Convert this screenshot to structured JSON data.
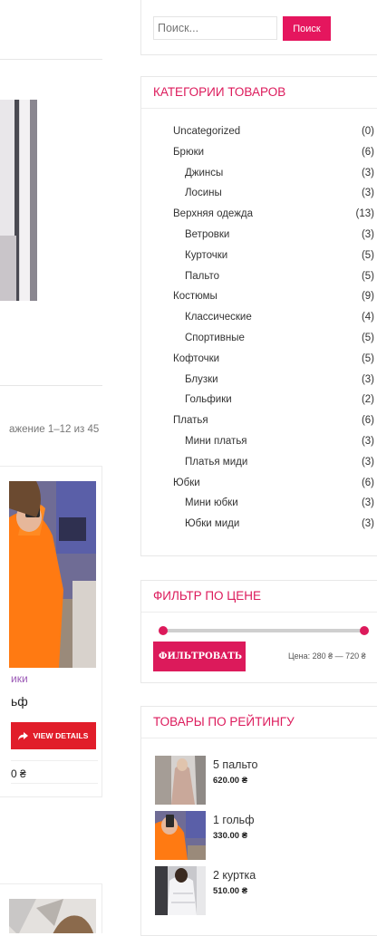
{
  "content": {
    "result_count": "ажение 1–12 из 45",
    "product_card": {
      "category": "ики",
      "name": "ьф",
      "button_label": "VIEW DETAILS",
      "price": "0 ₴"
    }
  },
  "search": {
    "placeholder": "Поиск...",
    "button_label": "Поиск"
  },
  "categories": {
    "title": "КАТЕГОРИИ ТОВАРОВ",
    "items": [
      {
        "label": "Uncategorized",
        "count": "(0)",
        "level": 0
      },
      {
        "label": "Брюки",
        "count": "(6)",
        "level": 0
      },
      {
        "label": "Джинсы",
        "count": "(3)",
        "level": 1
      },
      {
        "label": "Лосины",
        "count": "(3)",
        "level": 1
      },
      {
        "label": "Верхняя одежда",
        "count": "(13)",
        "level": 0
      },
      {
        "label": "Ветровки",
        "count": "(3)",
        "level": 1
      },
      {
        "label": "Курточки",
        "count": "(5)",
        "level": 1
      },
      {
        "label": "Пальто",
        "count": "(5)",
        "level": 1
      },
      {
        "label": "Костюмы",
        "count": "(9)",
        "level": 0
      },
      {
        "label": "Классические",
        "count": "(4)",
        "level": 1
      },
      {
        "label": "Спортивные",
        "count": "(5)",
        "level": 1
      },
      {
        "label": "Кофточки",
        "count": "(5)",
        "level": 0
      },
      {
        "label": "Блузки",
        "count": "(3)",
        "level": 1
      },
      {
        "label": "Гольфики",
        "count": "(2)",
        "level": 1
      },
      {
        "label": "Платья",
        "count": "(6)",
        "level": 0
      },
      {
        "label": "Мини платья",
        "count": "(3)",
        "level": 1
      },
      {
        "label": "Платья миди",
        "count": "(3)",
        "level": 1
      },
      {
        "label": "Юбки",
        "count": "(6)",
        "level": 0
      },
      {
        "label": "Мини юбки",
        "count": "(3)",
        "level": 1
      },
      {
        "label": "Юбки миди",
        "count": "(3)",
        "level": 1
      }
    ]
  },
  "price_filter": {
    "title": "ФИЛЬТР ПО ЦЕНЕ",
    "button_label": "ФИЛЬТРОВАТЬ",
    "range_text": "Цена: 280 ₴ — 720 ₴",
    "min_fraction": 0,
    "max_fraction": 1
  },
  "top_rated": {
    "title": "ТОВАРЫ ПО РЕЙТИНГУ",
    "items": [
      {
        "name": "5 пальто",
        "price": "620.00 ₴"
      },
      {
        "name": "1 гольф",
        "price": "330.00 ₴"
      },
      {
        "name": "2 куртка",
        "price": "510.00 ₴"
      }
    ]
  },
  "colors": {
    "accent": "#dc1a5b",
    "details_button": "#e11d2a",
    "category_link": "#9b59b6"
  }
}
